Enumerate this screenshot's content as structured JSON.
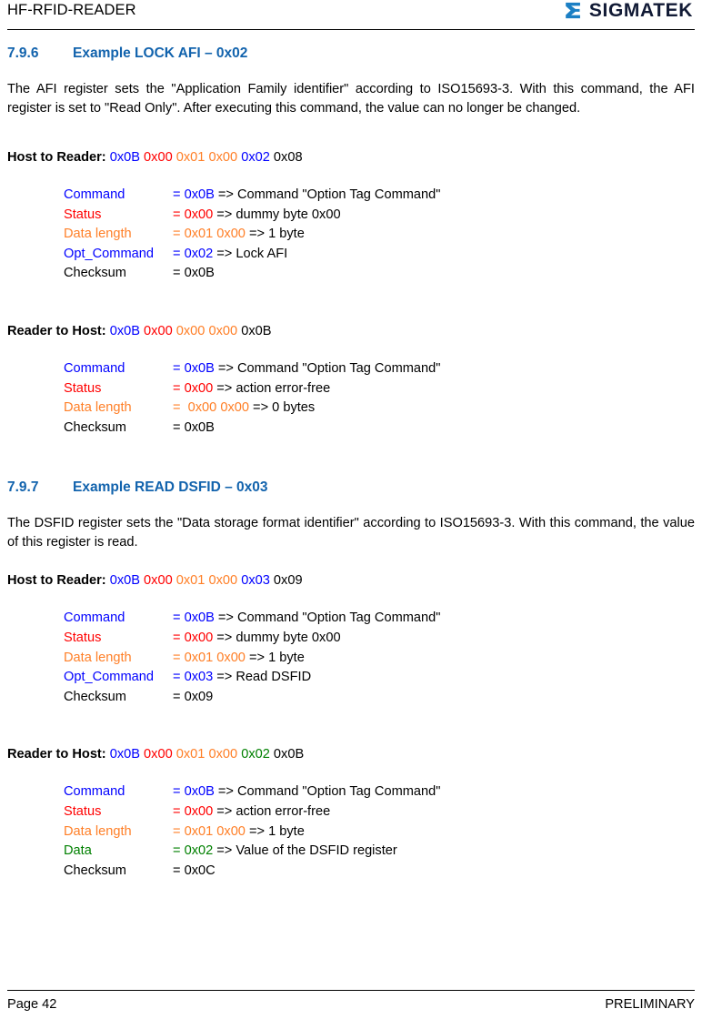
{
  "header": {
    "document_title": "HF-RFID-READER",
    "logo_text": "SIGMATEK",
    "logo_icon": "sigmatek-sigma-mark"
  },
  "colors": {
    "heading_blue": "#1263ad",
    "command_blue": "#0000ff",
    "status_red": "#ff0000",
    "length_orange": "#ff7f27",
    "data_green": "#008000",
    "checksum_black": "#000000"
  },
  "sections": [
    {
      "number": "7.9.6",
      "title": "Example LOCK AFI – 0x02",
      "paragraph": "The AFI register sets the \"Application Family identifier\" according to ISO15693-3. With this command, the AFI register is set to \"Read Only\". After executing this command, the value can no longer be changed.",
      "blocks": [
        {
          "label": "Host to Reader:",
          "bytes": [
            {
              "text": "0x0B",
              "color": "blue"
            },
            {
              "text": "0x00",
              "color": "red"
            },
            {
              "text": "0x01",
              "color": "orange"
            },
            {
              "text": "0x00",
              "color": "orange"
            },
            {
              "text": "0x02",
              "color": "blue"
            },
            {
              "text": "0x08",
              "color": "black"
            }
          ],
          "rows": [
            {
              "field": "Command",
              "color": "blue",
              "value_prefix": "= ",
              "value": "0x0B",
              "comment": " => Command \"Option Tag Command\""
            },
            {
              "field": "Status",
              "color": "red",
              "value_prefix": "= ",
              "value": "0x00",
              "comment": " => dummy byte 0x00"
            },
            {
              "field": "Data length",
              "color": "orange",
              "value_prefix": "= ",
              "value": "0x01 0x00",
              "comment": " => 1 byte"
            },
            {
              "field": "Opt_Command",
              "color": "blue",
              "value_prefix": "= ",
              "value": "0x02",
              "comment": " => Lock AFI"
            },
            {
              "field": "Checksum",
              "color": "black",
              "value_prefix": "= ",
              "value": "0x0B",
              "comment": ""
            }
          ]
        },
        {
          "label": "Reader to Host:",
          "bytes": [
            {
              "text": "0x0B",
              "color": "blue"
            },
            {
              "text": "0x00",
              "color": "red"
            },
            {
              "text": "0x00",
              "color": "orange"
            },
            {
              "text": "0x00",
              "color": "orange"
            },
            {
              "text": "0x0B",
              "color": "black"
            }
          ],
          "rows": [
            {
              "field": "Command",
              "color": "blue",
              "value_prefix": "= ",
              "value": "0x0B",
              "comment": " => Command \"Option Tag Command\""
            },
            {
              "field": "Status",
              "color": "red",
              "value_prefix": "= ",
              "value": "0x00",
              "comment": " => action error-free"
            },
            {
              "field": "Data length",
              "color": "orange",
              "value_prefix": "=  ",
              "value": "0x00 0x00",
              "comment": " => 0 bytes"
            },
            {
              "field": "Checksum",
              "color": "black",
              "value_prefix": "= ",
              "value": "0x0B",
              "comment": ""
            }
          ]
        }
      ]
    },
    {
      "number": "7.9.7",
      "title": "Example READ DSFID – 0x03",
      "paragraph": "The DSFID register sets the \"Data storage format identifier\" according to ISO15693-3. With this command, the value of this register is read.",
      "blocks": [
        {
          "label": "Host to Reader:",
          "bytes": [
            {
              "text": "0x0B",
              "color": "blue"
            },
            {
              "text": "0x00",
              "color": "red"
            },
            {
              "text": "0x01",
              "color": "orange"
            },
            {
              "text": "0x00",
              "color": "orange"
            },
            {
              "text": "0x03",
              "color": "blue"
            },
            {
              "text": "0x09",
              "color": "black"
            }
          ],
          "rows": [
            {
              "field": "Command",
              "color": "blue",
              "value_prefix": "= ",
              "value": "0x0B",
              "comment": " => Command \"Option Tag Command\""
            },
            {
              "field": "Status",
              "color": "red",
              "value_prefix": "= ",
              "value": "0x00",
              "comment": " => dummy byte 0x00"
            },
            {
              "field": "Data length",
              "color": "orange",
              "value_prefix": "= ",
              "value": "0x01 0x00",
              "comment": " => 1 byte"
            },
            {
              "field": "Opt_Command",
              "color": "blue",
              "value_prefix": "= ",
              "value": "0x03",
              "comment": " => Read DSFID"
            },
            {
              "field": "Checksum",
              "color": "black",
              "value_prefix": "= ",
              "value": "0x09",
              "comment": ""
            }
          ]
        },
        {
          "label": "Reader to Host:",
          "bytes": [
            {
              "text": "0x0B",
              "color": "blue"
            },
            {
              "text": "0x00",
              "color": "red"
            },
            {
              "text": "0x01",
              "color": "orange"
            },
            {
              "text": "0x00",
              "color": "orange"
            },
            {
              "text": "0x02",
              "color": "green"
            },
            {
              "text": "0x0B",
              "color": "black"
            }
          ],
          "rows": [
            {
              "field": "Command",
              "color": "blue",
              "value_prefix": "= ",
              "value": "0x0B",
              "comment": " => Command \"Option Tag Command\""
            },
            {
              "field": "Status",
              "color": "red",
              "value_prefix": "= ",
              "value": "0x00",
              "comment": " => action error-free"
            },
            {
              "field": "Data length",
              "color": "orange",
              "value_prefix": "= ",
              "value": "0x01 0x00",
              "comment": " => 1 byte"
            },
            {
              "field": "Data",
              "color": "green",
              "value_prefix": "= ",
              "value": "0x02",
              "comment": " => Value of the DSFID register"
            },
            {
              "field": "Checksum",
              "color": "black",
              "value_prefix": "= ",
              "value": "0x0C",
              "comment": ""
            }
          ]
        }
      ]
    }
  ],
  "footer": {
    "page_label": "Page 42",
    "status_label": "PRELIMINARY"
  }
}
